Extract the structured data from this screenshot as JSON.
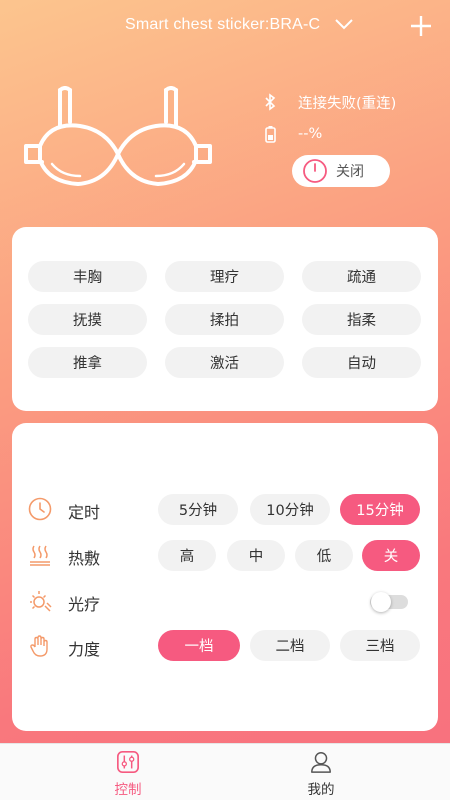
{
  "header": {
    "device_title": "Smart chest sticker:BRA-C",
    "dropdown_icon": "chevron-down-icon",
    "add_icon": "plus-icon"
  },
  "device": {
    "illustration_icon": "bra-icon",
    "connection_icon": "bluetooth-icon",
    "connection_status": "连接失败(重连)",
    "battery_icon": "battery-icon",
    "battery_level": "--%",
    "power_icon": "power-icon",
    "power_label": "关闭"
  },
  "modes": {
    "items": [
      "丰胸",
      "理疗",
      "疏通",
      "抚摸",
      "揉拍",
      "指柔",
      "推拿",
      "激活",
      "自动"
    ],
    "selected": null
  },
  "controls": {
    "timer": {
      "icon": "clock-icon",
      "label": "定时",
      "options": [
        "5分钟",
        "10分钟",
        "15分钟"
      ],
      "selected": "15分钟"
    },
    "heat": {
      "icon": "heat-icon",
      "label": "热敷",
      "options": [
        "高",
        "中",
        "低",
        "关"
      ],
      "selected": "关"
    },
    "light": {
      "icon": "light-therapy-icon",
      "label": "光疗",
      "enabled": false
    },
    "intensity": {
      "icon": "hand-icon",
      "label": "力度",
      "options": [
        "一档",
        "二档",
        "三档"
      ],
      "selected": "一档"
    }
  },
  "bottom_nav": {
    "items": [
      {
        "label": "控制",
        "icon": "control-icon",
        "active": true
      },
      {
        "label": "我的",
        "icon": "profile-icon",
        "active": false
      }
    ]
  },
  "colors": {
    "accent": "#f65a80",
    "pill_inactive": "#f2f2f2",
    "icon_orange": "#f49a6a"
  }
}
